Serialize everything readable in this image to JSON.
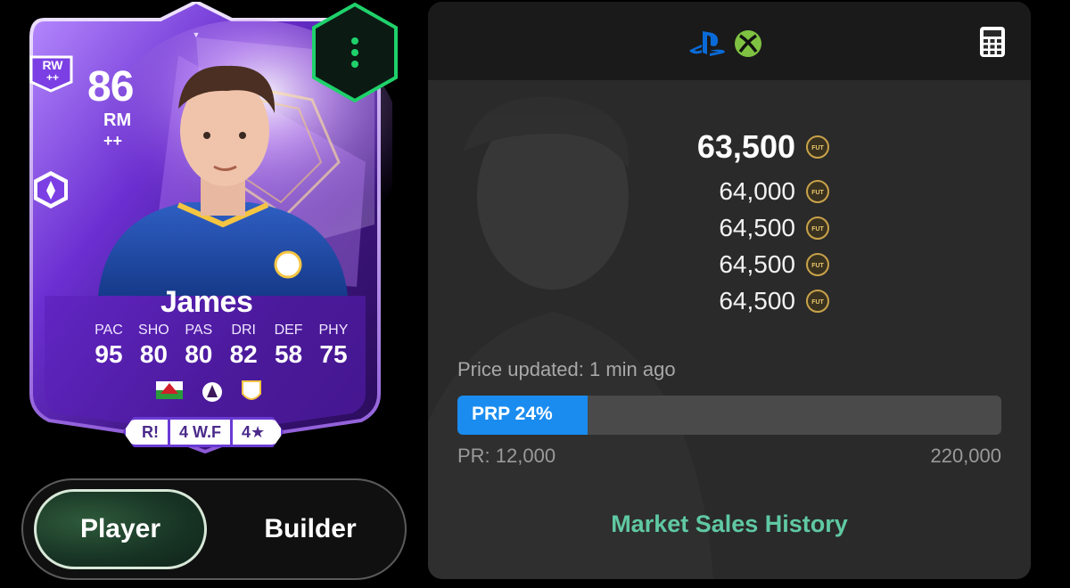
{
  "card": {
    "rating": "86",
    "position": "RM",
    "position_plus": "++",
    "alt_position": "RW",
    "alt_position_plus": "++",
    "name": "James",
    "stats": [
      {
        "label": "PAC",
        "value": "95"
      },
      {
        "label": "SHO",
        "value": "80"
      },
      {
        "label": "PAS",
        "value": "80"
      },
      {
        "label": "DRI",
        "value": "82"
      },
      {
        "label": "DEF",
        "value": "58"
      },
      {
        "label": "PHY",
        "value": "75"
      }
    ],
    "chips": [
      "R!",
      "4 W.F",
      "4★"
    ],
    "icons": [
      "playstyle-rocket-icon",
      "wales-flag-icon",
      "premier-league-icon",
      "leeds-crest-icon"
    ]
  },
  "toggle": {
    "player_label": "Player",
    "builder_label": "Builder"
  },
  "panel": {
    "platform_icons": [
      "playstation-icon",
      "xbox-icon"
    ],
    "calculator_icon": "calculator-icon",
    "prices": [
      "63,500",
      "64,000",
      "64,500",
      "64,500",
      "64,500"
    ],
    "coin_label": "FUT",
    "updated": "Price updated: 1 min ago",
    "prp_label": "PRP 24%",
    "prp_percent": 24,
    "pr_min": "PR: 12,000",
    "pr_max": "220,000",
    "history_link": "Market Sales History"
  },
  "colors": {
    "card_purple": "#7b3fe4",
    "prp_blue": "#1a8cf0",
    "history_green": "#5fc9a3",
    "hex_green": "#1fd16b"
  }
}
